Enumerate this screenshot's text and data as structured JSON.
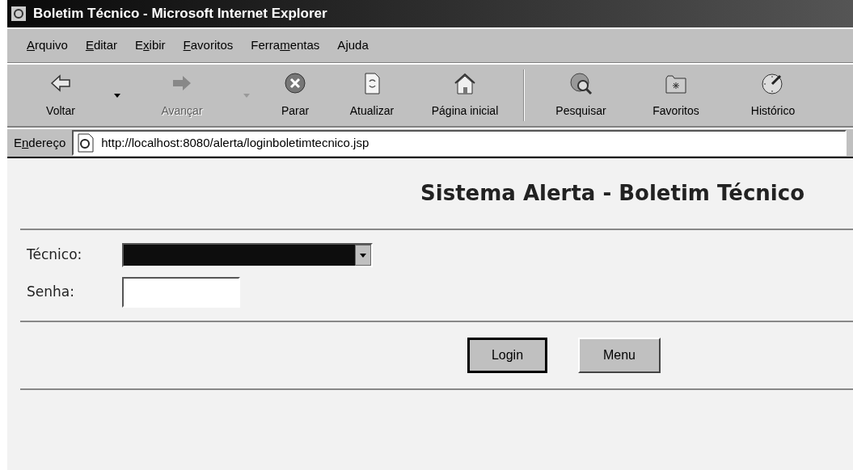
{
  "window": {
    "title": "Boletim Técnico - Microsoft Internet Explorer"
  },
  "menu": [
    {
      "key": "A",
      "post": "rquivo"
    },
    {
      "key": "E",
      "post": "ditar"
    },
    {
      "pre": "E",
      "key": "x",
      "post": "ibir"
    },
    {
      "key": "F",
      "post": "avoritos"
    },
    {
      "pre": "Ferra",
      "key": "m",
      "post": "entas"
    },
    {
      "pre": "A",
      "key": "j",
      "post": "uda"
    }
  ],
  "toolbar": [
    {
      "label": "Voltar",
      "disabled": false,
      "dropdown": true
    },
    {
      "label": "Avançar",
      "disabled": true,
      "dropdown": true
    },
    {
      "label": "Parar",
      "disabled": false,
      "dropdown": false
    },
    {
      "label": "Atualizar",
      "disabled": false,
      "dropdown": false
    },
    {
      "label": "Página inicial",
      "disabled": false,
      "dropdown": false
    },
    {
      "label": "Pesquisar",
      "disabled": false,
      "dropdown": false
    },
    {
      "label": "Favoritos",
      "disabled": false,
      "dropdown": false
    },
    {
      "label": "Histórico",
      "disabled": false,
      "dropdown": false
    }
  ],
  "address": {
    "label": {
      "pre": "E",
      "key": "n",
      "post": "dereço"
    },
    "value": "http://localhost:8080/alerta/loginboletimtecnico.jsp"
  },
  "page": {
    "heading": "Sistema Alerta - Boletim Técnico",
    "fields": [
      {
        "kind": "select",
        "label": "Técnico:"
      },
      {
        "kind": "password",
        "label": "Senha:"
      }
    ],
    "buttons": [
      {
        "label": "Login",
        "default": true
      },
      {
        "label": "Menu",
        "default": false
      }
    ]
  }
}
